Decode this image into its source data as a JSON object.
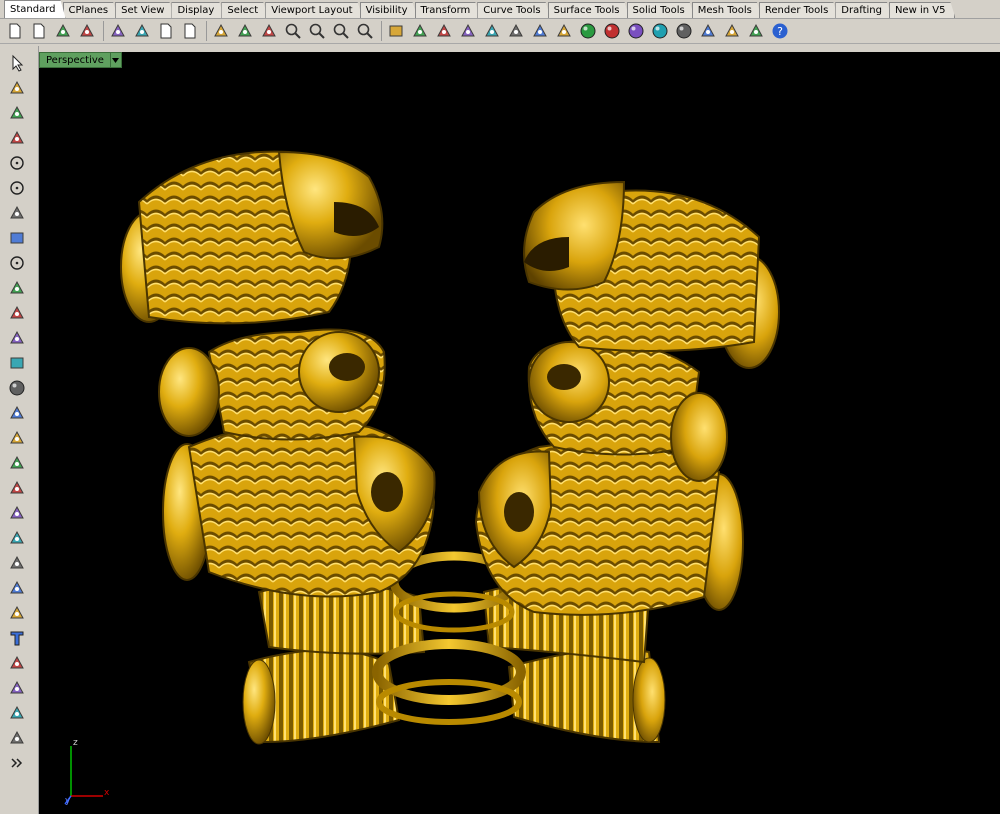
{
  "tabs": [
    "Standard",
    "CPlanes",
    "Set View",
    "Display",
    "Select",
    "Viewport Layout",
    "Visibility",
    "Transform",
    "Curve Tools",
    "Surface Tools",
    "Solid Tools",
    "Mesh Tools",
    "Render Tools",
    "Drafting",
    "New in V5"
  ],
  "active_tab": "Standard",
  "viewport": {
    "title": "Perspective"
  },
  "axes": {
    "z": "z",
    "x": "x",
    "y": "y"
  },
  "toolbar_icons": [
    "new-file-icon",
    "open-file-icon",
    "save-icon",
    "print-icon",
    "import-icon",
    "cut-icon",
    "copy-icon",
    "paste-icon",
    "undo-icon",
    "pan-hand-icon",
    "rotate-view-icon",
    "zoom-icon",
    "zoom-window-icon",
    "zoom-extents-icon",
    "zoom-selected-icon",
    "four-viewports-icon",
    "car-icon",
    "options-icon",
    "layers-icon",
    "properties-icon",
    "light-bulb-icon",
    "lock-icon",
    "shade-icon",
    "color-wheel-icon",
    "render-sphere-icon",
    "render-sphere-alt-icon",
    "ghosted-sphere-icon",
    "globe-icon",
    "pointer-flag-icon",
    "settings-gear-icon",
    "grid-snap-icon",
    "help-icon"
  ],
  "leftbar_icons": [
    "select-arrow-icon",
    "point-icon",
    "polyline-icon",
    "curve-icon",
    "circle-icon",
    "ellipse-icon",
    "polygon-icon",
    "rectangle-icon",
    "circle-tool-icon",
    "arc-icon",
    "surface-icon",
    "loft-icon",
    "box-icon",
    "sphere-icon",
    "cylinder-icon",
    "plane-icon",
    "transform-icon",
    "explode-icon",
    "split-icon",
    "boolean-icon",
    "points-icon",
    "curve-edit-icon",
    "fillet-icon",
    "text-icon",
    "dimension-icon",
    "array-icon",
    "analyze-icon",
    "render-icon",
    "more-icon"
  ],
  "colors": {
    "gold": "#e0ad10",
    "gold_dark": "#7a5a00",
    "gold_light": "#ffe070",
    "viewport_bg": "#000000",
    "label_green": "#5fa05f"
  }
}
